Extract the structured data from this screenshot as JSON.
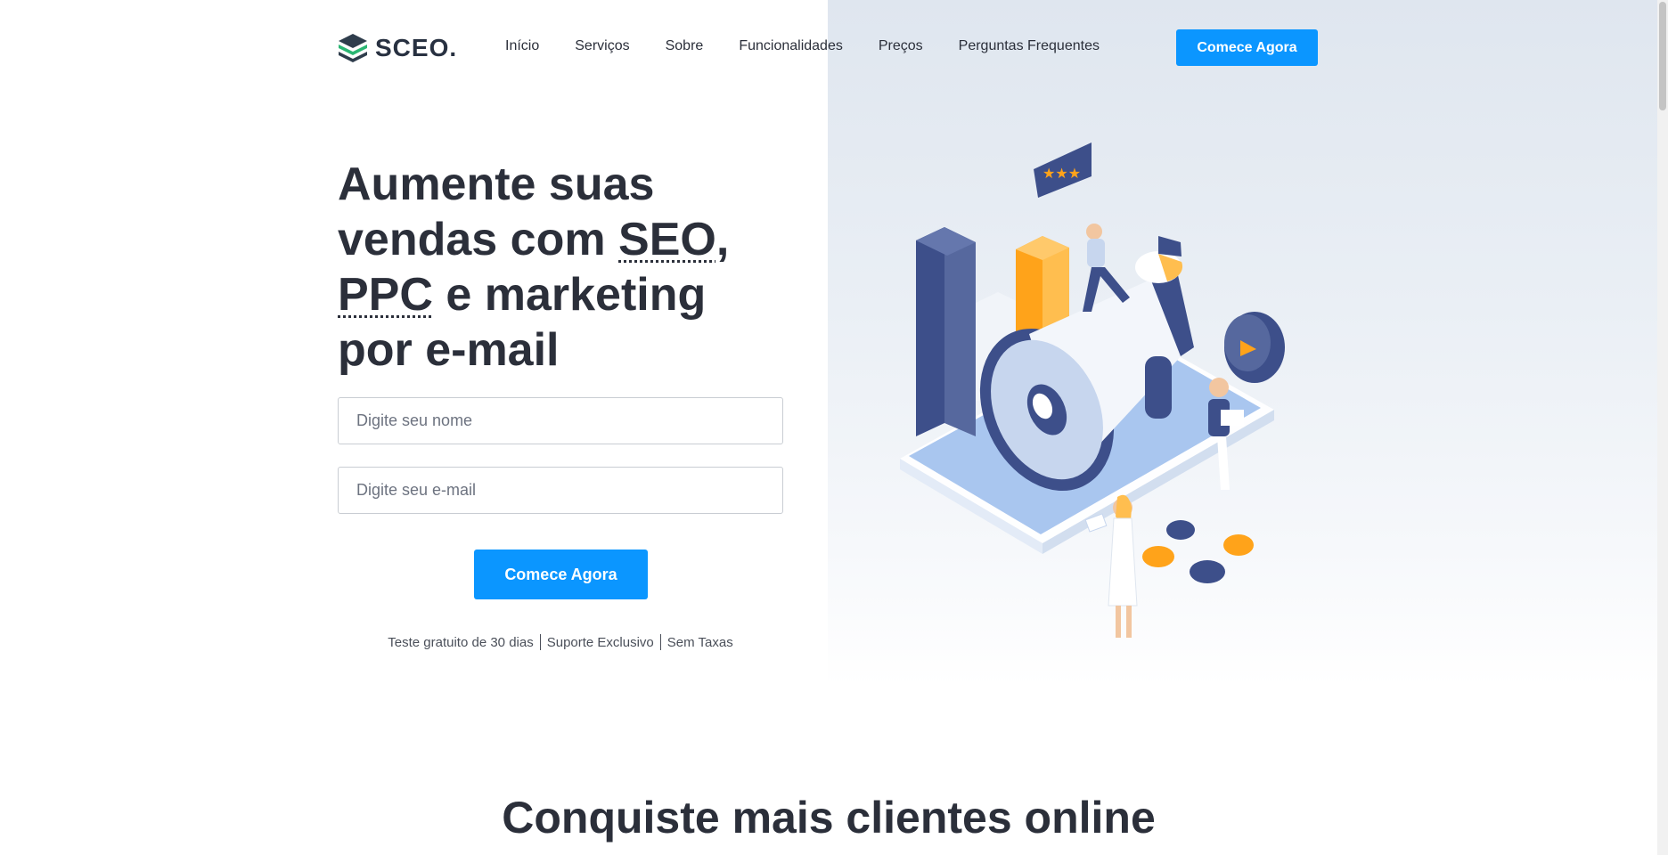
{
  "brand": {
    "name": "SCEO.",
    "icon": "stacked-layers-logo-icon"
  },
  "nav": {
    "items": [
      {
        "label": "Início"
      },
      {
        "label": "Serviços"
      },
      {
        "label": "Sobre"
      },
      {
        "label": "Funcionalidades"
      },
      {
        "label": "Preços"
      },
      {
        "label": "Perguntas Frequentes"
      }
    ],
    "cta_label": "Comece Agora"
  },
  "hero": {
    "title_line1": "Aumente suas",
    "title_line2_pre": "vendas com ",
    "title_abbr1": "SEO",
    "title_line2_post": ",",
    "title_abbr2": "PPC",
    "title_line3_post": " e marketing",
    "title_line4": "por e-mail",
    "name_placeholder": "Digite seu nome",
    "email_placeholder": "Digite seu e-mail",
    "cta_label": "Comece Agora",
    "perks": [
      "Teste gratuito de 30 dias",
      "Suporte Exclusivo",
      "Sem Taxas"
    ]
  },
  "section": {
    "title": "Conquiste mais clientes online"
  },
  "colors": {
    "accent": "#0b96ff",
    "text": "#2b2f3a",
    "illustration_navy": "#3d4f8a",
    "illustration_orange": "#ffa31a",
    "illustration_light_blue": "#a9c6ef"
  }
}
